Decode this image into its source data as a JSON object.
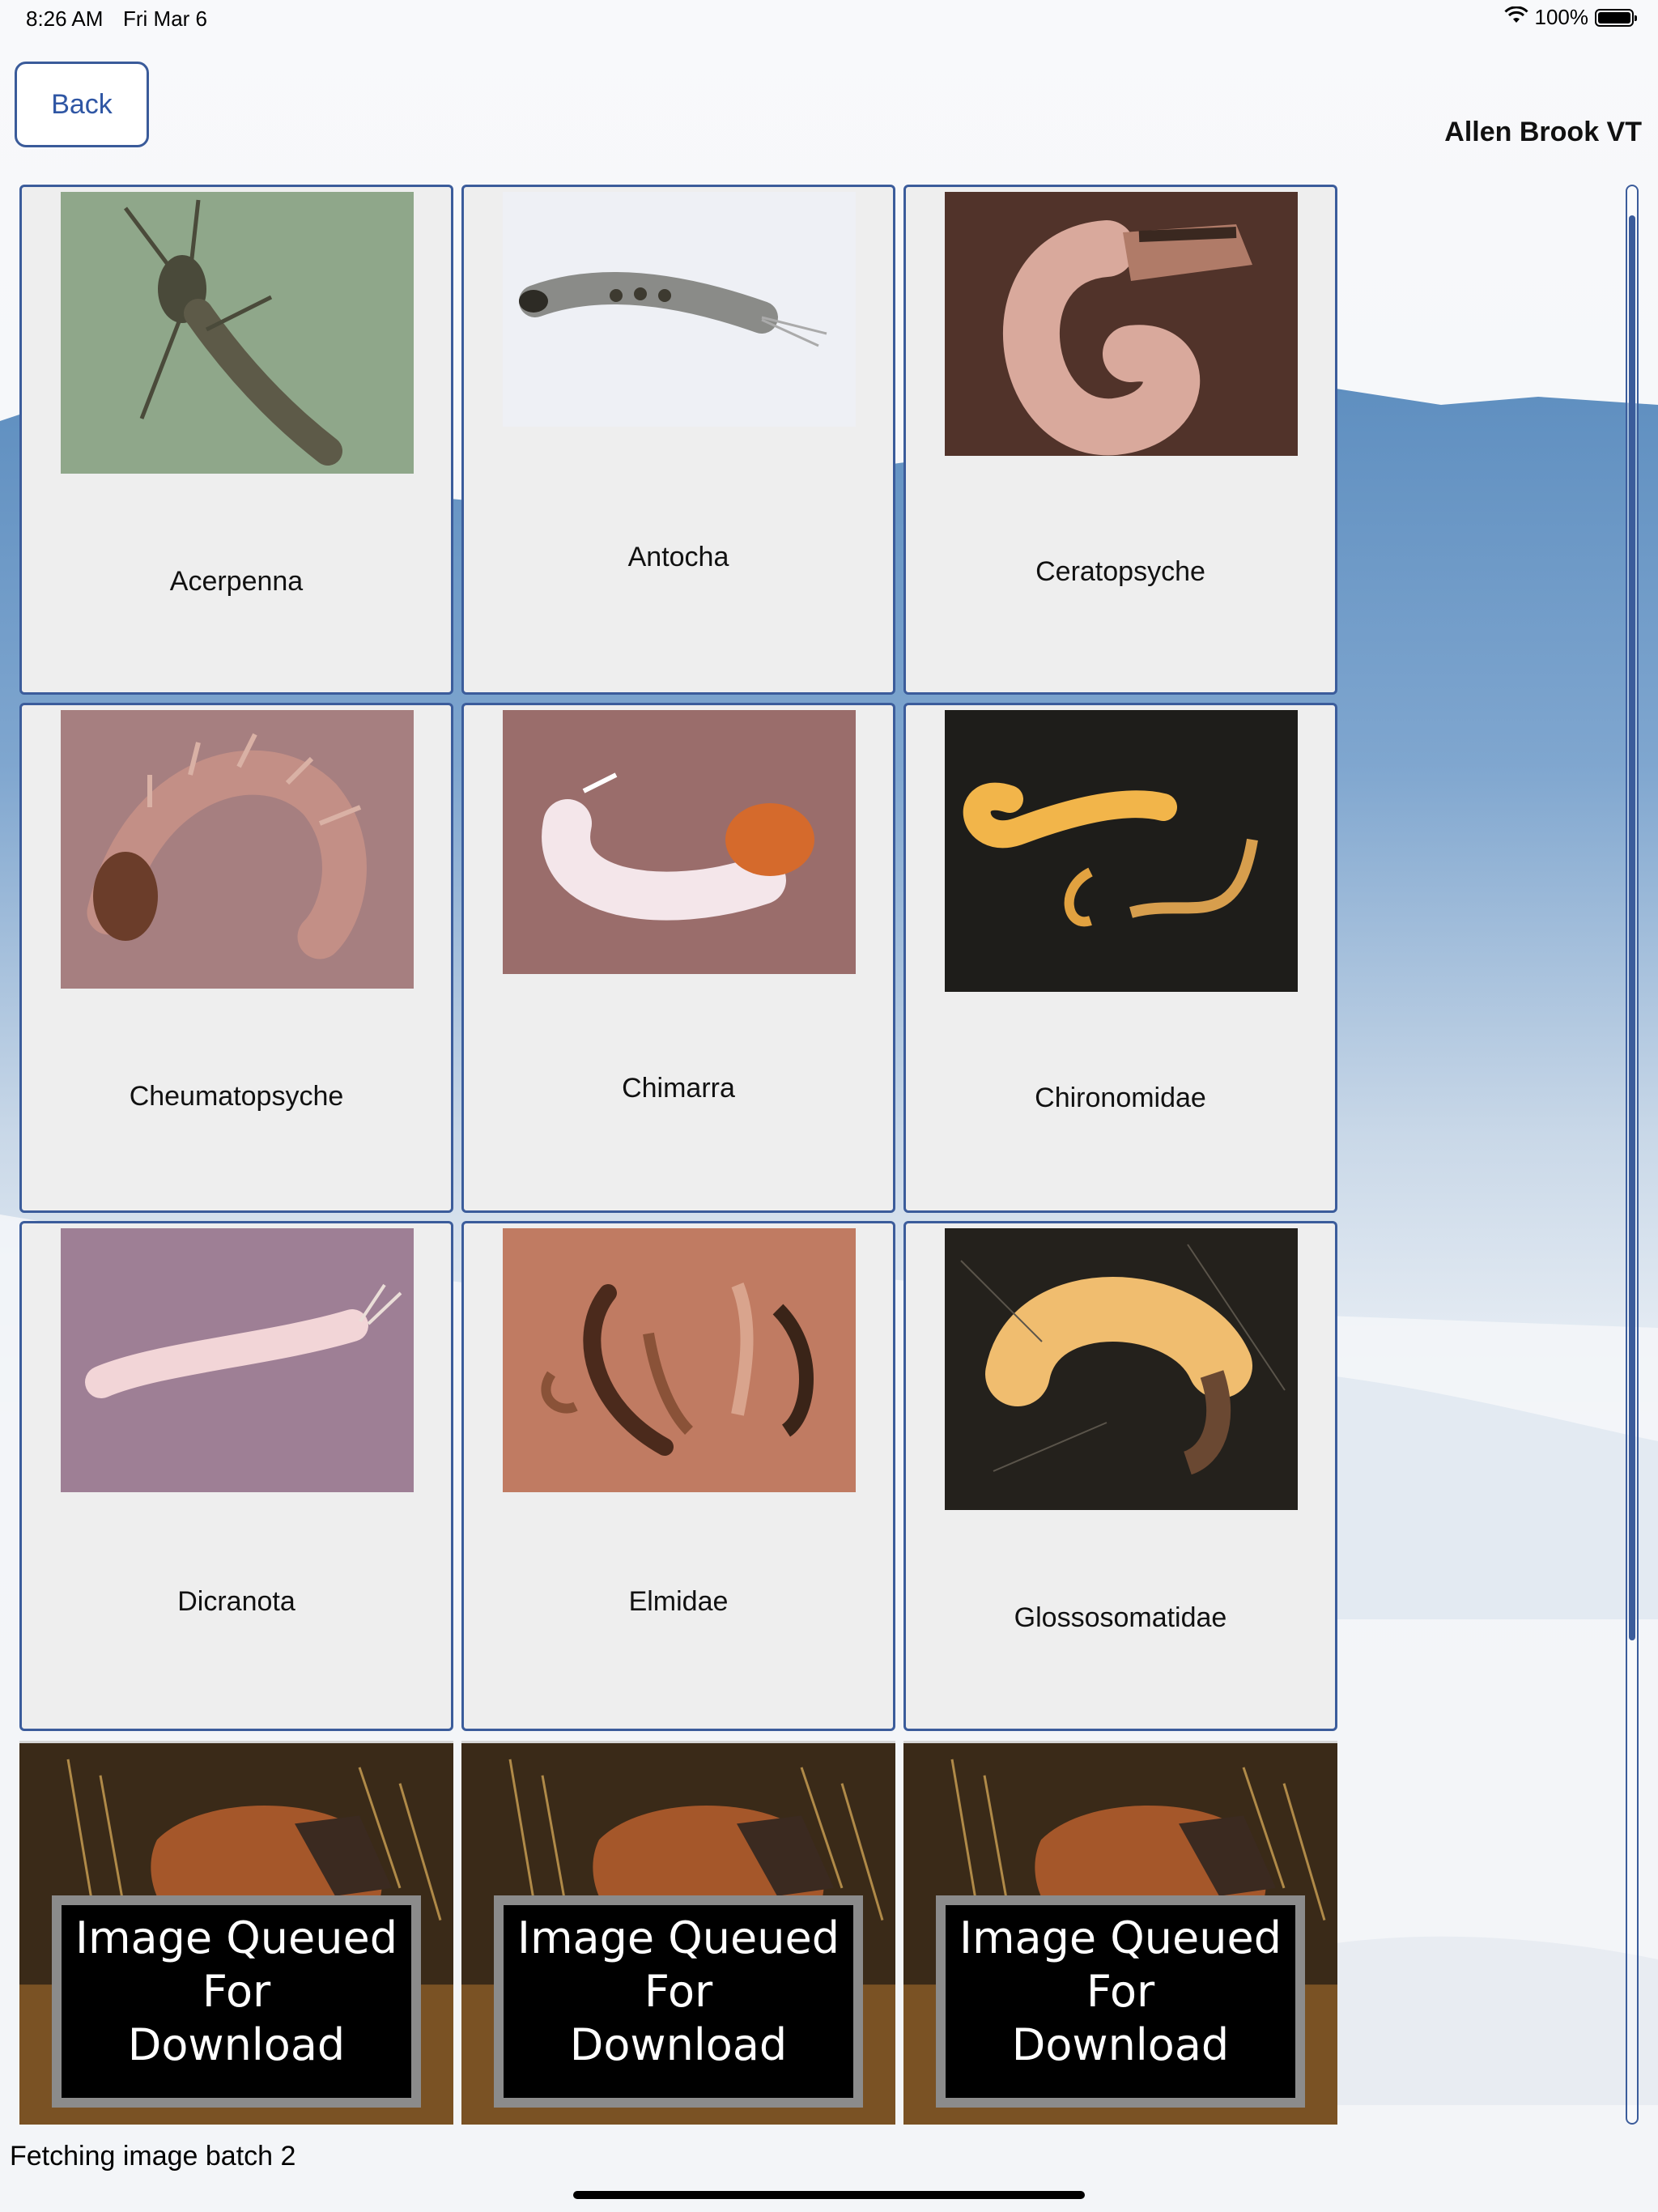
{
  "status_bar": {
    "time": "8:26 AM",
    "date": "Fri Mar 6",
    "battery": "100%"
  },
  "header": {
    "back_label": "Back",
    "site_name": "Allen Brook VT"
  },
  "taxa": [
    {
      "name": "Acerpenna"
    },
    {
      "name": "Antocha"
    },
    {
      "name": "Ceratopsyche"
    },
    {
      "name": "Cheumatopsyche"
    },
    {
      "name": "Chimarra"
    },
    {
      "name": "Chironomidae"
    },
    {
      "name": "Dicranota"
    },
    {
      "name": "Elmidae"
    },
    {
      "name": "Glossosomatidae"
    }
  ],
  "queued": {
    "line1": "Image Queued",
    "line2": "For",
    "line3": "Download"
  },
  "footer": {
    "status": "Fetching image batch 2"
  },
  "colors": {
    "accent": "#3b5c9b",
    "card_bg": "#eeeeee"
  }
}
